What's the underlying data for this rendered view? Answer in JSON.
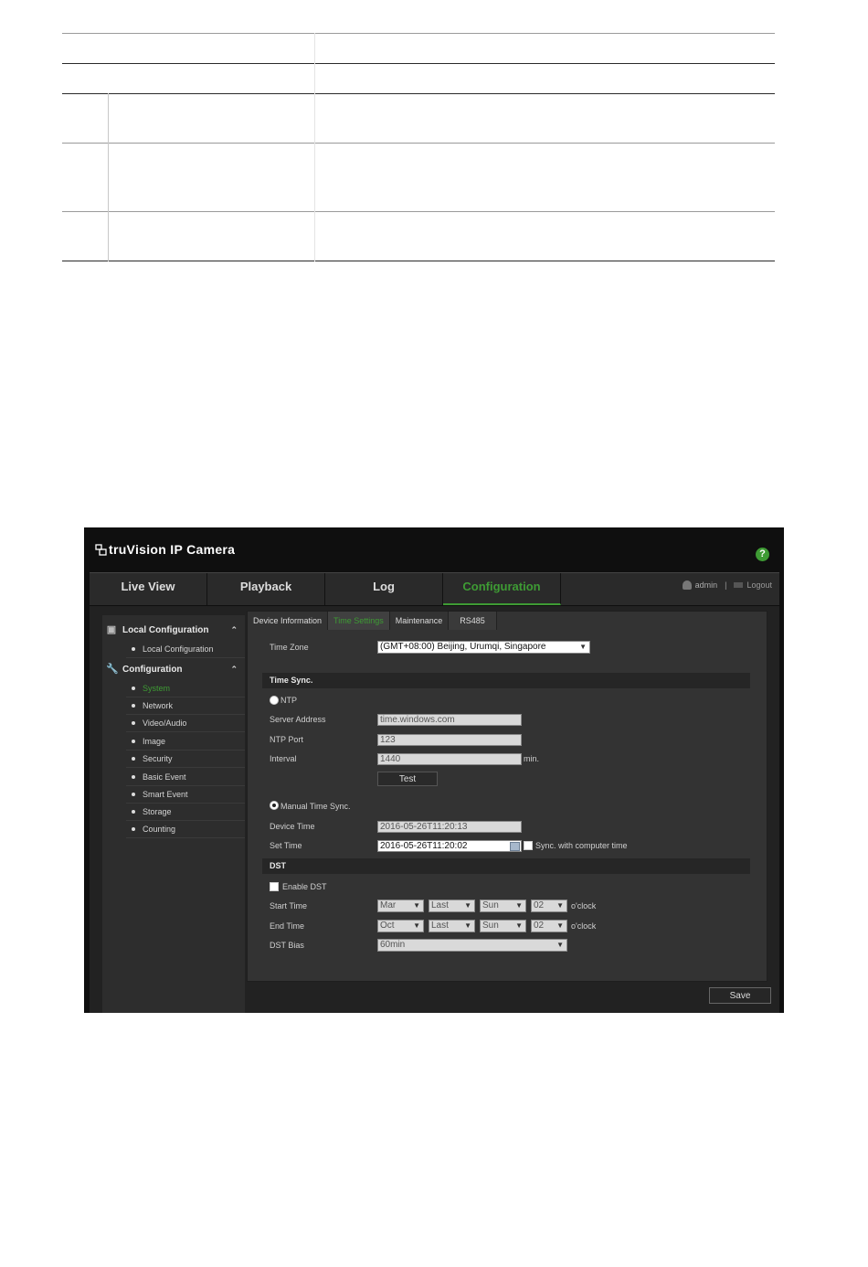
{
  "app": {
    "brand": "truVision IP Camera",
    "help_glyph": "?"
  },
  "nav": {
    "tabs": [
      {
        "label": "Live View"
      },
      {
        "label": "Playback"
      },
      {
        "label": "Log"
      },
      {
        "label": "Configuration"
      }
    ],
    "user": "admin",
    "separator": "|",
    "logout": "Logout"
  },
  "sidebar": {
    "local_header": "Local Configuration",
    "local_items": [
      "Local Configuration"
    ],
    "config_header": "Configuration",
    "config_items": [
      "System",
      "Network",
      "Video/Audio",
      "Image",
      "Security",
      "Basic Event",
      "Smart Event",
      "Storage",
      "Counting"
    ]
  },
  "subtabs": [
    "Device Information",
    "Time Settings",
    "Maintenance",
    "RS485"
  ],
  "form": {
    "time_zone_label": "Time Zone",
    "time_zone_value": "(GMT+08:00) Beijing, Urumqi, Singapore",
    "time_sync_header": "Time Sync.",
    "ntp_label": "NTP",
    "server_address_label": "Server Address",
    "server_address_value": "time.windows.com",
    "ntp_port_label": "NTP Port",
    "ntp_port_value": "123",
    "interval_label": "Interval",
    "interval_value": "1440",
    "interval_unit": "min.",
    "test_button": "Test",
    "manual_sync_label": "Manual Time Sync.",
    "device_time_label": "Device Time",
    "device_time_value": "2016-05-26T11:20:13",
    "set_time_label": "Set Time",
    "set_time_value": "2016-05-26T11:20:02",
    "sync_computer_label": "Sync. with computer time",
    "dst_header": "DST",
    "enable_dst_label": "Enable DST",
    "start_time_label": "Start Time",
    "start_time": {
      "month": "Mar",
      "week": "Last",
      "day": "Sun",
      "hour": "02"
    },
    "end_time_label": "End Time",
    "end_time": {
      "month": "Oct",
      "week": "Last",
      "day": "Sun",
      "hour": "02"
    },
    "oclock": "o'clock",
    "dst_bias_label": "DST Bias",
    "dst_bias_value": "60min",
    "save_button": "Save"
  }
}
